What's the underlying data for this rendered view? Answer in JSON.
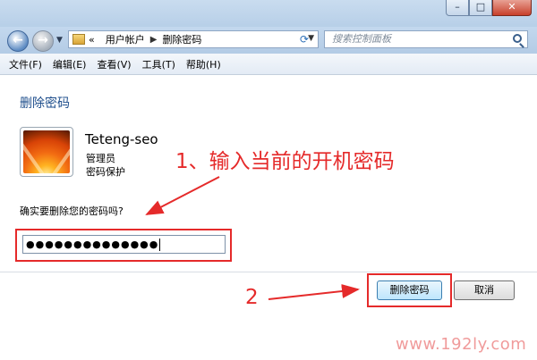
{
  "window": {
    "minimize_glyph": "–",
    "maximize_glyph": "□",
    "close_glyph": "✕"
  },
  "navigation": {
    "back_glyph": "←",
    "forward_glyph": "→",
    "breadcrumb": [
      "«",
      "用户帐户",
      "删除密码"
    ],
    "search_placeholder": "搜索控制面板"
  },
  "menu": [
    "文件(F)",
    "编辑(E)",
    "查看(V)",
    "工具(T)",
    "帮助(H)"
  ],
  "page": {
    "title": "删除密码",
    "user_name": "Teteng-seo",
    "user_role": "管理员",
    "user_status": "密码保护",
    "question": "确实要删除您的密码吗?",
    "password_masked": "●●●●●●●●●●●●●●",
    "delete_button": "删除密码",
    "cancel_button": "取消"
  },
  "annotations": {
    "step1": "1、输入当前的开机密码",
    "step2": "2",
    "color": "#e52a2a"
  },
  "watermark": "www.192ly.com"
}
